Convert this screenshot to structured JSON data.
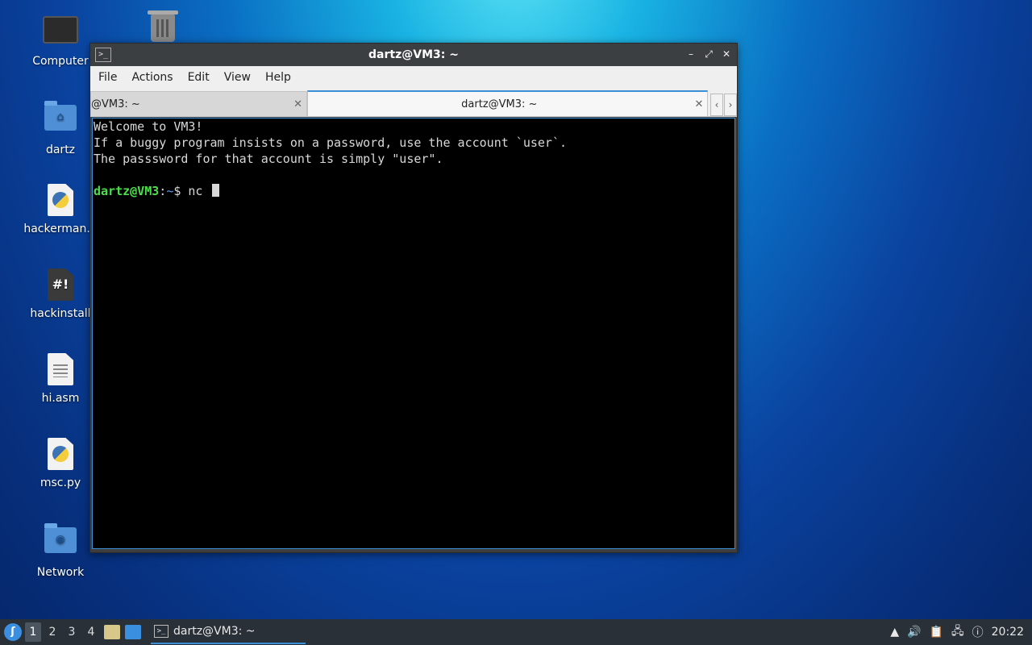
{
  "desktop": {
    "icons": [
      {
        "label": "Computer",
        "icon": "computer-icon"
      },
      {
        "label": "",
        "icon": "trash-icon"
      },
      {
        "label": "dartz",
        "icon": "home-folder-icon"
      },
      {
        "label": "hackerman.p",
        "icon": "python-file-icon"
      },
      {
        "label": "hackinstall",
        "icon": "script-file-icon"
      },
      {
        "label": "hi.asm",
        "icon": "text-file-icon"
      },
      {
        "label": "msc.py",
        "icon": "python-file-icon"
      },
      {
        "label": "Network",
        "icon": "network-folder-icon"
      }
    ]
  },
  "window": {
    "title": "dartz@VM3: ~",
    "menu": [
      "File",
      "Actions",
      "Edit",
      "View",
      "Help"
    ],
    "tabs": [
      {
        "label": "@VM3: ~",
        "active": false
      },
      {
        "label": "dartz@VM3: ~",
        "active": true
      }
    ],
    "controls": {
      "minimize": "–",
      "maximize": "⤢",
      "close": "✕"
    }
  },
  "terminal": {
    "lines": [
      "Welcome to VM3!",
      "If a buggy program insists on a password, use the account `user`.",
      "The passsword for that account is simply \"user\"."
    ],
    "prompt_user": "dartz@VM3",
    "prompt_sep": ":",
    "prompt_path": "~",
    "prompt_symbol": "$ ",
    "command": "nc "
  },
  "taskbar": {
    "start_icon": "start-menu-icon",
    "workspaces": [
      "1",
      "2",
      "3",
      "4"
    ],
    "active_workspace": "1",
    "task_label": "dartz@VM3: ~",
    "clock": "20:22"
  },
  "colors": {
    "accent": "#3b8fd6",
    "prompt_user": "#4be04b",
    "prompt_path": "#5b9bf5",
    "terminal_bg": "#000000"
  }
}
